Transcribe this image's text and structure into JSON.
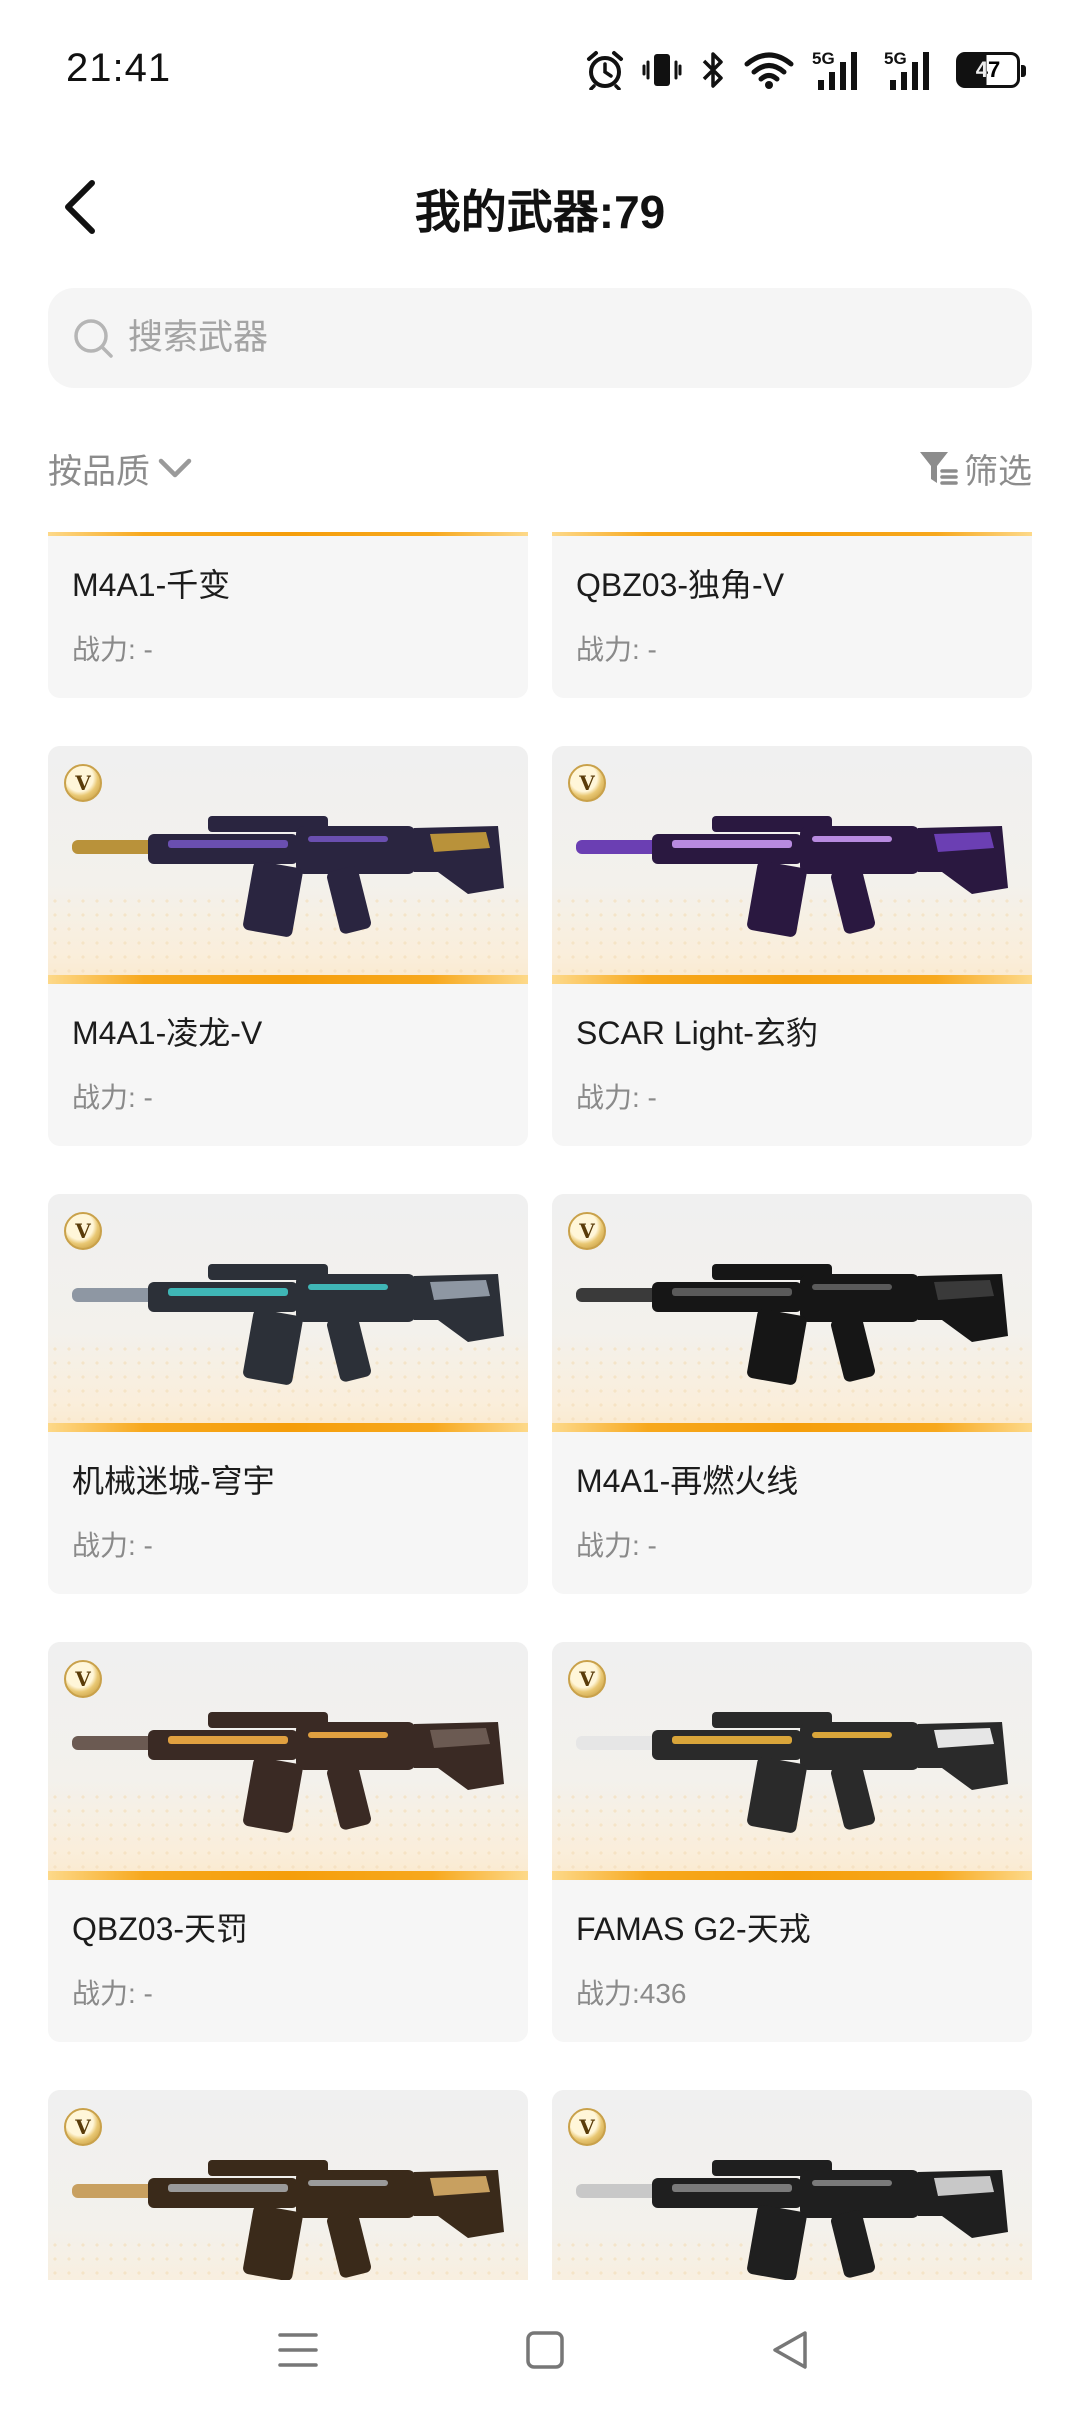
{
  "status_bar": {
    "time": "21:41",
    "battery_level": "47",
    "icons": [
      "alarm-icon",
      "vibrate-icon",
      "bluetooth-icon",
      "wifi-icon",
      "signal-5g-icon",
      "signal-5g-icon",
      "battery-icon"
    ],
    "signal_label": "5G"
  },
  "header": {
    "title": "我的武器:79",
    "back_icon": "back-arrow-icon"
  },
  "search": {
    "placeholder": "搜索武器",
    "value": ""
  },
  "filters": {
    "sort_label": "按品质",
    "filter_label": "筛选"
  },
  "badge_letter": "V",
  "weapons": [
    {
      "name": "M4A1-千变",
      "power": "战力: -",
      "palette": [
        "#3d3d4a",
        "#8a8fa0",
        "#c9a54a"
      ]
    },
    {
      "name": "QBZ03-独角-V",
      "power": "战力: -",
      "palette": [
        "#2e2a3d",
        "#7b6aa8",
        "#c9c2e0"
      ]
    },
    {
      "name": "M4A1-凌龙-V",
      "power": "战力: -",
      "palette": [
        "#2a2540",
        "#b9923a",
        "#6a4fb0"
      ]
    },
    {
      "name": "SCAR Light-玄豹",
      "power": "战力: -",
      "palette": [
        "#2a1840",
        "#6b3fb3",
        "#b88ae0"
      ]
    },
    {
      "name": "机械迷城-穹宇",
      "power": "战力: -",
      "palette": [
        "#2c3038",
        "#8e97a3",
        "#3fb6b6"
      ]
    },
    {
      "name": "M4A1-再燃火线",
      "power": "战力: -",
      "palette": [
        "#161616",
        "#3a3a3a",
        "#5a5a5a"
      ]
    },
    {
      "name": "QBZ03-天罚",
      "power": "战力: -",
      "palette": [
        "#3a2a24",
        "#6b5a52",
        "#e0a040"
      ]
    },
    {
      "name": "FAMAS G2-天戎",
      "power": "战力:436",
      "palette": [
        "#2a2a2a",
        "#e6e6e6",
        "#d9a53a"
      ]
    },
    {
      "name": "",
      "power": "",
      "palette": [
        "#3a2a1a",
        "#c8a060",
        "#9a9a9a"
      ]
    },
    {
      "name": "",
      "power": "",
      "palette": [
        "#1f1f1f",
        "#c8c8c8",
        "#7a7a7a"
      ]
    }
  ],
  "nav": {
    "menu_icon": "menu-icon",
    "home_icon": "home-square-icon",
    "back_icon": "back-triangle-icon"
  }
}
